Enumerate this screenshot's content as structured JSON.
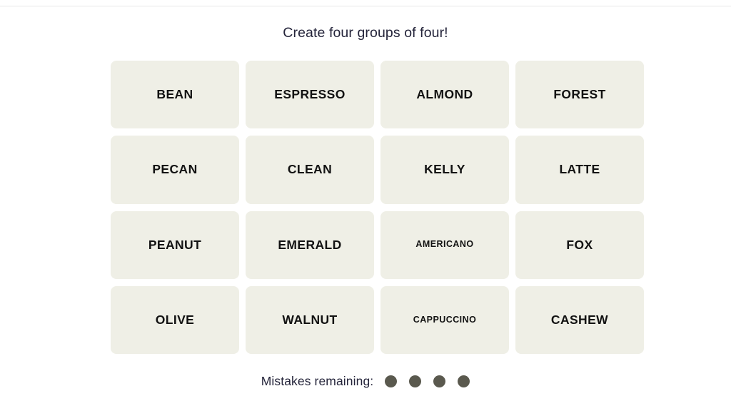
{
  "game": {
    "instruction": "Create four groups of four!",
    "tile_bg_color": "#EFEFE6",
    "tile_text_color": "#121212",
    "instruction_color": "#24243A",
    "dot_color": "#5A594E"
  },
  "board": {
    "columns": 4,
    "rows": 4,
    "tiles": [
      {
        "label": "BEAN",
        "size": "normal"
      },
      {
        "label": "ESPRESSO",
        "size": "normal"
      },
      {
        "label": "ALMOND",
        "size": "normal"
      },
      {
        "label": "FOREST",
        "size": "normal"
      },
      {
        "label": "PECAN",
        "size": "normal"
      },
      {
        "label": "CLEAN",
        "size": "normal"
      },
      {
        "label": "KELLY",
        "size": "normal"
      },
      {
        "label": "LATTE",
        "size": "normal"
      },
      {
        "label": "PEANUT",
        "size": "normal"
      },
      {
        "label": "EMERALD",
        "size": "normal"
      },
      {
        "label": "AMERICANO",
        "size": "small"
      },
      {
        "label": "FOX",
        "size": "normal"
      },
      {
        "label": "OLIVE",
        "size": "normal"
      },
      {
        "label": "WALNUT",
        "size": "normal"
      },
      {
        "label": "CAPPUCCINO",
        "size": "small"
      },
      {
        "label": "CASHEW",
        "size": "normal"
      }
    ]
  },
  "footer": {
    "mistakes_label": "Mistakes remaining:",
    "mistakes_remaining": 4
  }
}
